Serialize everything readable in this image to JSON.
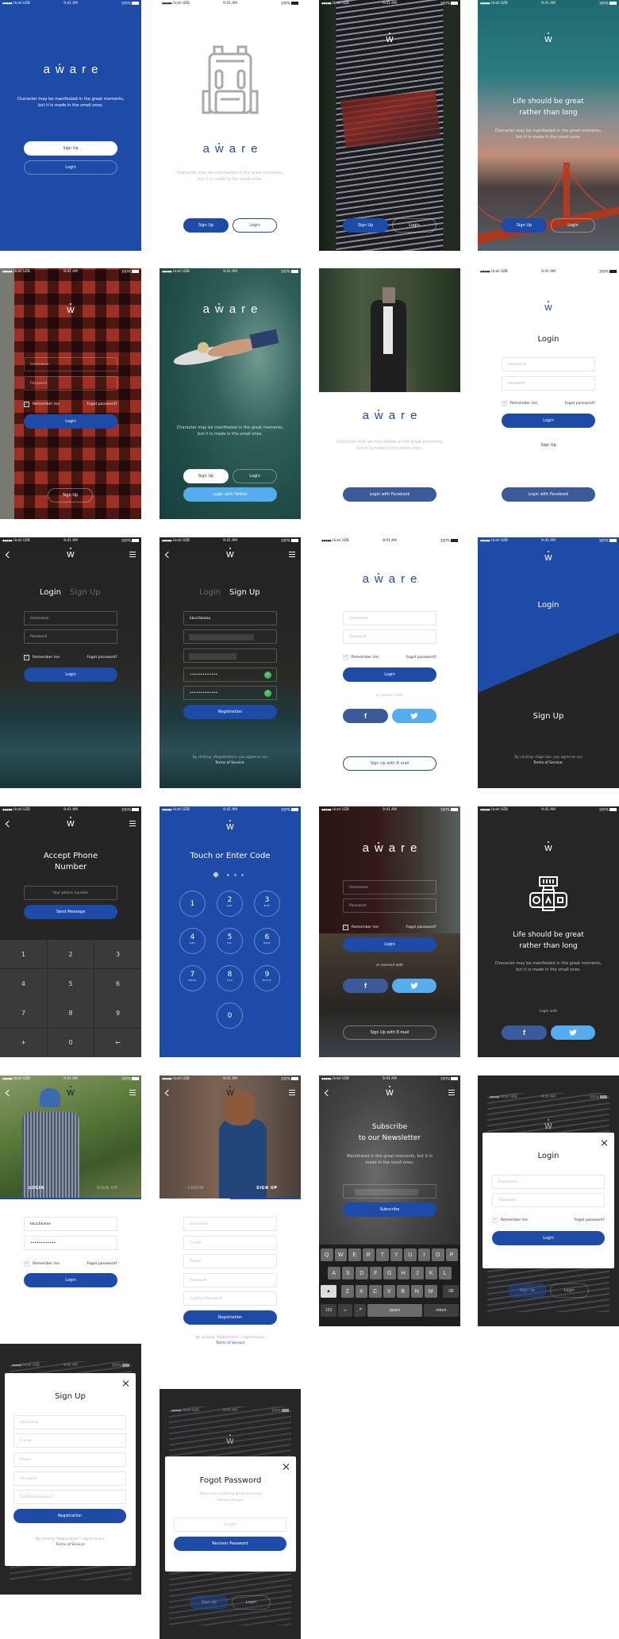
{
  "status": {
    "carrier": "Ucell UZB",
    "time": "9:41 AM",
    "battery": "100%"
  },
  "brand": {
    "logo": "aware",
    "mark": "w",
    "primary": "#1f4ba8",
    "facebook": "#3b5a9a",
    "twitter": "#55acee",
    "dark": "#252525"
  },
  "copy": {
    "tagline": "Character may be manifested in the great moments, but it is made in the small ones.",
    "headline": "Life should be great\nrather than long"
  },
  "labels": {
    "sign_up": "Sign Up",
    "login": "Login",
    "username": "Username",
    "password": "Password",
    "remember_me": "Remember me",
    "forgot_password": "Fogot password?",
    "login_facebook": "Login with Facebook",
    "login_twitter": "Login with Twitter",
    "or_connect": "or connect with",
    "signup_email": "Sign Up with E-mail",
    "registration": "Registration",
    "email": "E-mail",
    "phone": "Phone",
    "confirm_password": "Confirm Password",
    "login_with": "Login with",
    "terms_link": "Terms of Service.",
    "terms_link_plain": "Terms of Service"
  },
  "screens": {
    "white_login": {
      "title": "Login"
    },
    "dark_tabs": {
      "login_tab": "Login",
      "signup_tab": "Sign Up"
    },
    "dark_signup": {
      "username_value": "kkuchkarov",
      "password_mask": "•••••••••••••",
      "terms_text": "By clicking «Registration» you agree to our"
    },
    "split": {
      "login": "Login",
      "sign_up": "Sign Up",
      "terms_text": "By clicking «Sign Up» you agree to our"
    },
    "phone": {
      "title": "Accept Phone\nNumber",
      "placeholder": "Your phone number",
      "send": "Send Message",
      "keys": [
        "1",
        "2",
        "3",
        "4",
        "5",
        "6",
        "7",
        "8",
        "9",
        "+",
        "0",
        "←"
      ]
    },
    "code": {
      "title": "Touch or Enter Code",
      "entered": 1,
      "length": 4,
      "keys": [
        {
          "digit": "1",
          "letters": ""
        },
        {
          "digit": "2",
          "letters": "ABC"
        },
        {
          "digit": "3",
          "letters": "DEF"
        },
        {
          "digit": "4",
          "letters": "GHI"
        },
        {
          "digit": "5",
          "letters": "JKL"
        },
        {
          "digit": "6",
          "letters": "MNO"
        },
        {
          "digit": "7",
          "letters": "PQRS"
        },
        {
          "digit": "8",
          "letters": "TUV"
        },
        {
          "digit": "9",
          "letters": "WXYZ"
        },
        {
          "digit": "0",
          "letters": ""
        }
      ]
    },
    "photo_tabs": {
      "login_tab": "LOGIN",
      "signup_tab": "SIGN UP",
      "username_value": "kkuchkarov",
      "password_mask": "••••••••••••",
      "terms_text": "By clicking \"Registration\" I agree to our"
    },
    "newsletter": {
      "title": "Subscribe\nto our Newsletter",
      "text": "Manifested in the great moments, but it is made in the small ones.",
      "subscribe": "Subscribe",
      "keyboard": {
        "rows": [
          [
            "Q",
            "W",
            "E",
            "R",
            "T",
            "Y",
            "U",
            "I",
            "O",
            "P"
          ],
          [
            "A",
            "S",
            "D",
            "F",
            "G",
            "H",
            "J",
            "K",
            "L"
          ],
          [
            "Z",
            "X",
            "C",
            "V",
            "B",
            "N",
            "M"
          ]
        ],
        "numbers": "123",
        "space": "space",
        "return": "return"
      }
    },
    "modal_login": {
      "title": "Login"
    },
    "modal_signup": {
      "title": "Sign Up"
    },
    "forgot": {
      "title": "Fogot Password",
      "text": "Never was anything great achieved without danger.",
      "recover": "Recover Password"
    }
  }
}
